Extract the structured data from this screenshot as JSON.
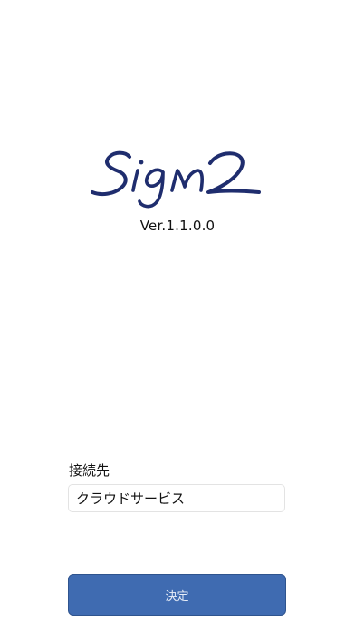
{
  "app": {
    "logo_text": "Sign2",
    "version": "Ver.1.1.0.0"
  },
  "connection": {
    "label": "接続先",
    "value": "クラウドサービス"
  },
  "actions": {
    "decide_label": "決定"
  },
  "colors": {
    "logo": "#1f2d6e",
    "button": "#3f6bb1",
    "button_text": "#e8eef8",
    "field_border": "#e3e3e3"
  }
}
